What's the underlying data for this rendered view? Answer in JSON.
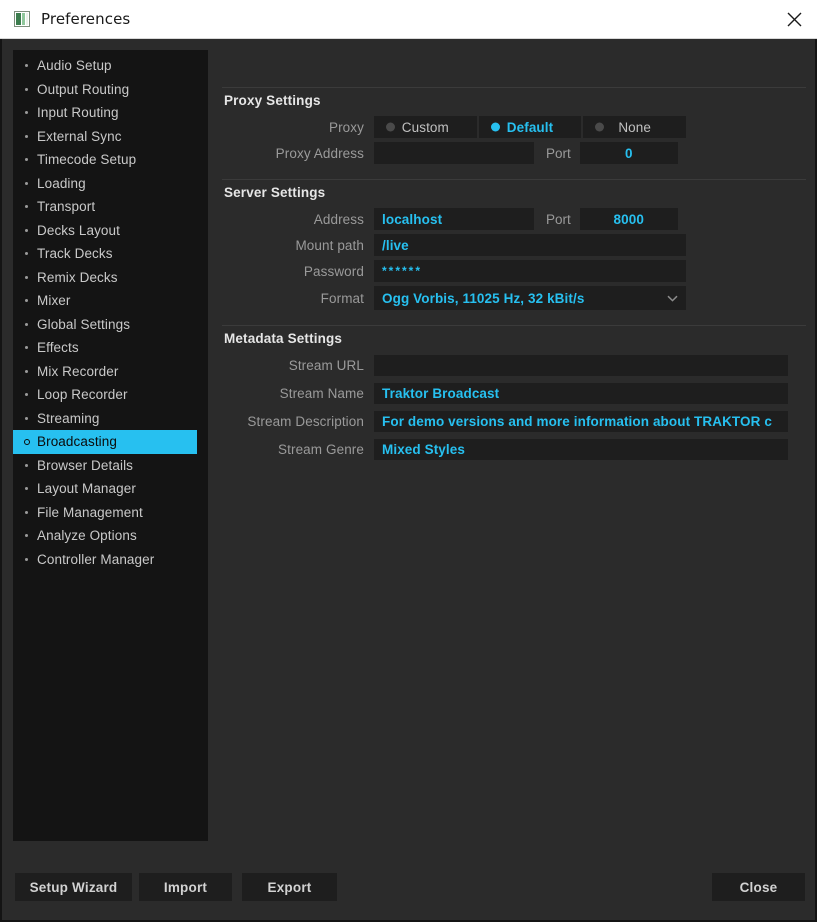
{
  "window": {
    "title": "Preferences",
    "icon": "preferences-window-icon",
    "close_icon": "close-icon"
  },
  "colors": {
    "accent": "#27c0f0",
    "selected_row_bg": "#27c0f0",
    "panel_bg": "#2b2b2b",
    "sidebar_bg": "#141414",
    "field_bg": "#1e1e1e",
    "label_text": "#9a9a9a",
    "titlebar_bg": "#ffffff"
  },
  "sidebar": {
    "items": [
      {
        "label": "Audio Setup",
        "selected": false
      },
      {
        "label": "Output Routing",
        "selected": false
      },
      {
        "label": "Input Routing",
        "selected": false
      },
      {
        "label": "External Sync",
        "selected": false
      },
      {
        "label": "Timecode Setup",
        "selected": false
      },
      {
        "label": "Loading",
        "selected": false
      },
      {
        "label": "Transport",
        "selected": false
      },
      {
        "label": "Decks Layout",
        "selected": false
      },
      {
        "label": "Track Decks",
        "selected": false
      },
      {
        "label": "Remix Decks",
        "selected": false
      },
      {
        "label": "Mixer",
        "selected": false
      },
      {
        "label": "Global Settings",
        "selected": false
      },
      {
        "label": "Effects",
        "selected": false
      },
      {
        "label": "Mix Recorder",
        "selected": false
      },
      {
        "label": "Loop Recorder",
        "selected": false
      },
      {
        "label": "Streaming",
        "selected": false
      },
      {
        "label": "Broadcasting",
        "selected": true
      },
      {
        "label": "Browser Details",
        "selected": false
      },
      {
        "label": "Layout Manager",
        "selected": false
      },
      {
        "label": "File Management",
        "selected": false
      },
      {
        "label": "Analyze Options",
        "selected": false
      },
      {
        "label": "Controller Manager",
        "selected": false
      }
    ]
  },
  "proxy_settings": {
    "title": "Proxy Settings",
    "proxy_label": "Proxy",
    "options": [
      "Custom",
      "Default",
      "None"
    ],
    "selected": "Default",
    "address_label": "Proxy Address",
    "address_value": "",
    "port_label": "Port",
    "port_value": "0"
  },
  "server_settings": {
    "title": "Server Settings",
    "address_label": "Address",
    "address_value": "localhost",
    "port_label": "Port",
    "port_value": "8000",
    "mount_label": "Mount path",
    "mount_value": "/live",
    "password_label": "Password",
    "password_value": "******",
    "format_label": "Format",
    "format_value": "Ogg Vorbis, 11025 Hz, 32 kBit/s",
    "format_chevron": "chevron-down-icon"
  },
  "metadata_settings": {
    "title": "Metadata Settings",
    "stream_url_label": "Stream URL",
    "stream_url_value": "",
    "stream_name_label": "Stream Name",
    "stream_name_value": "Traktor Broadcast",
    "stream_description_label": "Stream Description",
    "stream_description_value": "For demo versions and more information about TRAKTOR c",
    "stream_genre_label": "Stream Genre",
    "stream_genre_value": "Mixed Styles"
  },
  "footer": {
    "setup_wizard": "Setup Wizard",
    "import": "Import",
    "export": "Export",
    "close": "Close"
  }
}
